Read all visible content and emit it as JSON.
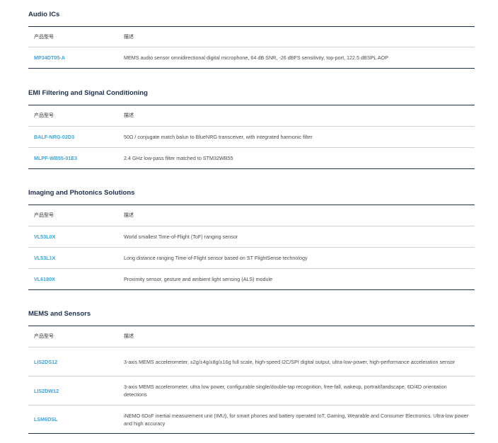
{
  "columns": {
    "part_number": "产品型号",
    "description": "描述"
  },
  "sections": [
    {
      "title": "Audio ICs",
      "rows": [
        {
          "pn": "MP34DT05-A",
          "desc": "MEMS audio sensor omnidirectional digital microphone, 64 dB SNR, -26 dBFS sensitivity, top-port, 122.5 dBSPL AOP"
        }
      ]
    },
    {
      "title": "EMI Filtering and Signal Conditioning",
      "rows": [
        {
          "pn": "BALF-NRG-02D3",
          "desc": "50Ω / conjugate match balun to BlueNRG transceiver, with integrated harmonic filter"
        },
        {
          "pn": "MLPF-WB55-01E3",
          "desc": "2.4 GHz low-pass filter matched to STM32WB55"
        }
      ]
    },
    {
      "title": "Imaging and Photonics Solutions",
      "rows": [
        {
          "pn": "VL53L0X",
          "desc": "World smallest Time-of-Flight (ToF) ranging sensor"
        },
        {
          "pn": "VL53L1X",
          "desc": "Long distance ranging Time-of-Flight sensor based on ST FlightSense technology"
        },
        {
          "pn": "VL6180X",
          "desc": "Proximity sensor, gesture and ambient light sensing (ALS) module"
        }
      ]
    },
    {
      "title": "MEMS and Sensors",
      "rows": [
        {
          "pn": "LIS2DS12",
          "desc": "3-axis MEMS accelerometer, ±2g/±4g/±8g/±16g full scale, high-speed I2C/SPI digital output, ultra-low-power, high-performance acceleration sensor"
        },
        {
          "pn": "LIS2DW12",
          "desc": "3-axis MEMS accelerometer, ultra low power, configurable single/double-tap recognition, free-fall, wakeup, portrait/landscape, 6D/4D orientation detections"
        },
        {
          "pn": "LSM6DSL",
          "desc": "iNEMO 6DoF inertial measurement unit (IMU), for smart phones and battery operated IoT, Gaming, Wearable and Consumer Electronics. Ultra-low power and high accuracy"
        }
      ]
    }
  ]
}
